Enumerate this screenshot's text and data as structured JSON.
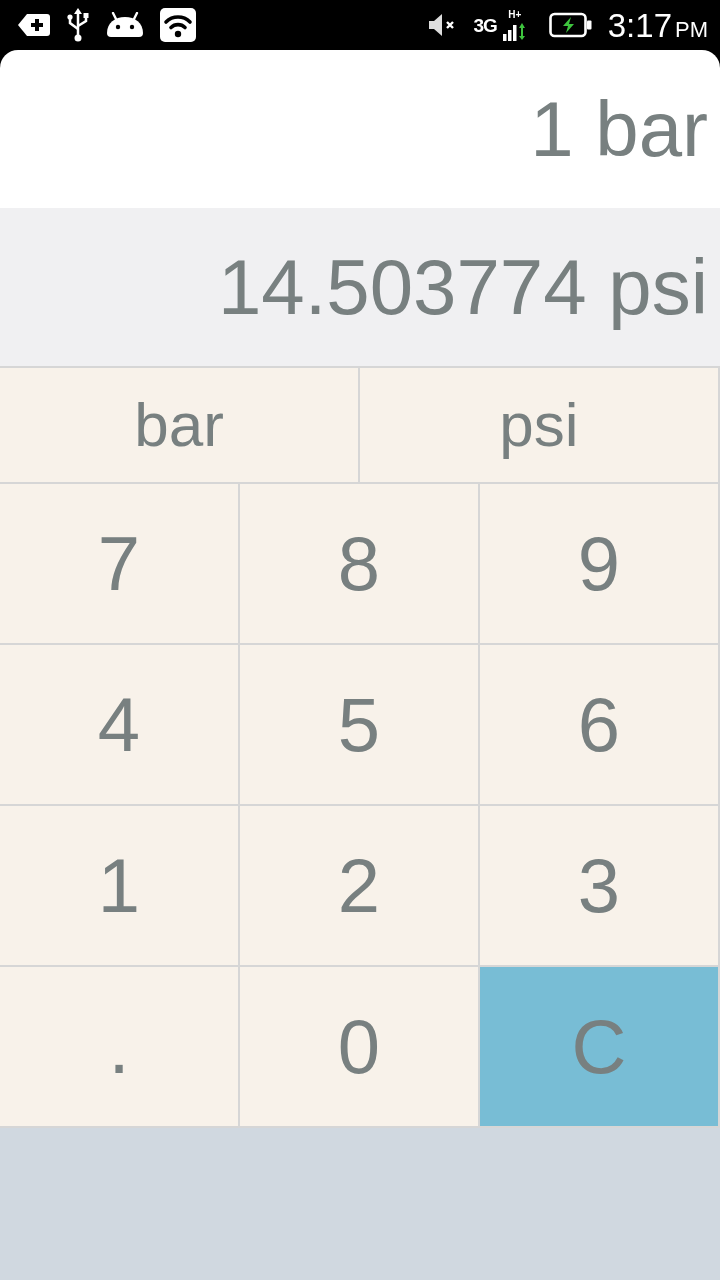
{
  "status_bar": {
    "network": "3G",
    "network_badge": "H+",
    "time": "3:17",
    "time_period": "PM"
  },
  "display": {
    "input": "1 bar",
    "result": "14.503774 psi"
  },
  "unit_buttons": [
    {
      "label": "bar"
    },
    {
      "label": "psi"
    }
  ],
  "keys": [
    {
      "label": "7",
      "kind": "input"
    },
    {
      "label": "8",
      "kind": "input"
    },
    {
      "label": "9",
      "kind": "input"
    },
    {
      "label": "4",
      "kind": "input"
    },
    {
      "label": "5",
      "kind": "input"
    },
    {
      "label": "6",
      "kind": "input"
    },
    {
      "label": "1",
      "kind": "input"
    },
    {
      "label": "2",
      "kind": "input"
    },
    {
      "label": "3",
      "kind": "input"
    },
    {
      "label": ".",
      "kind": "input"
    },
    {
      "label": "0",
      "kind": "input"
    },
    {
      "label": "C",
      "kind": "clear"
    }
  ]
}
